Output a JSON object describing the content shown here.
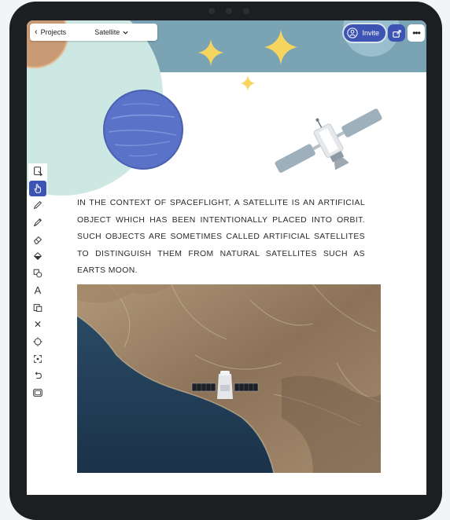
{
  "colors": {
    "accent": "#3e54b4",
    "header_band": "#7aa3b4",
    "mint_circle": "#cde8e2",
    "star": "#f6d55f",
    "planet": "#5a72c7",
    "ocean": "#1f3a52",
    "land": "#a3896b"
  },
  "nav": {
    "back_label": "Projects",
    "document_title": "Satellite"
  },
  "actions": {
    "invite_label": "Invite",
    "share_icon": "share-icon",
    "more_icon": "more-icon",
    "more_glyph": "•••"
  },
  "toolbar": {
    "tools": [
      "select-icon",
      "hand-icon",
      "pencil-icon",
      "pen-icon",
      "eraser-icon",
      "fill-icon",
      "shapes-icon",
      "text-icon",
      "image-icon",
      "close-icon",
      "target-icon",
      "crop-icon",
      "undo-icon",
      "frame-icon"
    ],
    "text_tool_glyph": "A",
    "close_tool_glyph": "✕",
    "active_tool": "hand-icon"
  },
  "content": {
    "paragraph": "IN THE CONTEXT OF SPACEFLIGHT, A SATELLITE IS AN ARTIFICIAL OBJECT WHICH HAS BEEN INTENTIONALLY PLACED INTO ORBIT. SUCH OBJECTS ARE SOMETIMES CALLED ARTIFICIAL SATELLITES TO DISTINGUISH THEM FROM NATURAL SATELLITES SUCH AS EARTS  MOON."
  }
}
